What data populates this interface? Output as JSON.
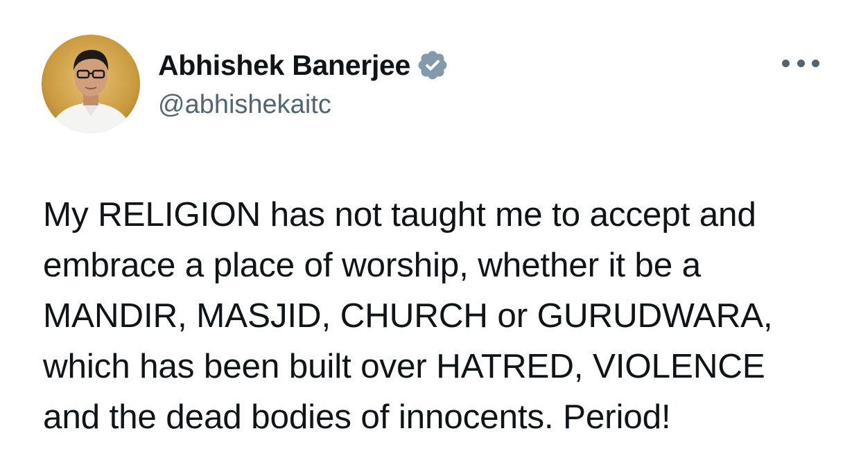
{
  "author": {
    "display_name": "Abhishek Banerjee",
    "handle": "@abhishekaitc",
    "verified": true,
    "verified_color": "#829aab",
    "avatar_icon": "profile-photo"
  },
  "tweet": {
    "lines": [
      "My RELIGION has not taught me to accept and",
      "embrace a place of worship, whether it be a",
      "MANDIR, MASJID, CHURCH or GURUDWARA,",
      "which has been built over HATRED, VIOLENCE",
      "and the dead bodies of innocents. Period!"
    ]
  },
  "menu": {
    "icon": "more-options-icon"
  },
  "colors": {
    "text_primary": "#0f1419",
    "text_secondary": "#536471",
    "background": "#ffffff"
  }
}
